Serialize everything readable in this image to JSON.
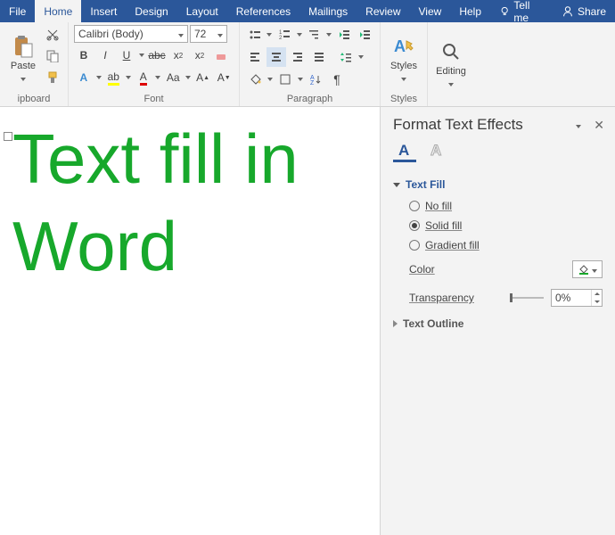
{
  "tabs": {
    "file": "File",
    "home": "Home",
    "insert": "Insert",
    "design": "Design",
    "layout": "Layout",
    "references": "References",
    "mailings": "Mailings",
    "review": "Review",
    "view": "View",
    "help": "Help",
    "tellme": "Tell me",
    "share": "Share"
  },
  "ribbon": {
    "clipboard": {
      "label": "ipboard",
      "paste": "Paste"
    },
    "font": {
      "label": "Font",
      "name": "Calibri (Body)",
      "size": "72"
    },
    "paragraph": {
      "label": "Paragraph"
    },
    "styles": {
      "label": "Styles",
      "button": "Styles"
    },
    "editing": {
      "label": "",
      "button": "Editing"
    }
  },
  "document": {
    "text_line1": "Text fill in",
    "text_line2": "Word"
  },
  "pane": {
    "title": "Format Text Effects",
    "fill": {
      "head": "Text Fill",
      "nofill": "No fill",
      "solid": "Solid fill",
      "gradient": "Gradient fill",
      "color": "Color",
      "transparency": "Transparency",
      "transparency_value": "0%"
    },
    "outline": {
      "head": "Text Outline"
    }
  }
}
